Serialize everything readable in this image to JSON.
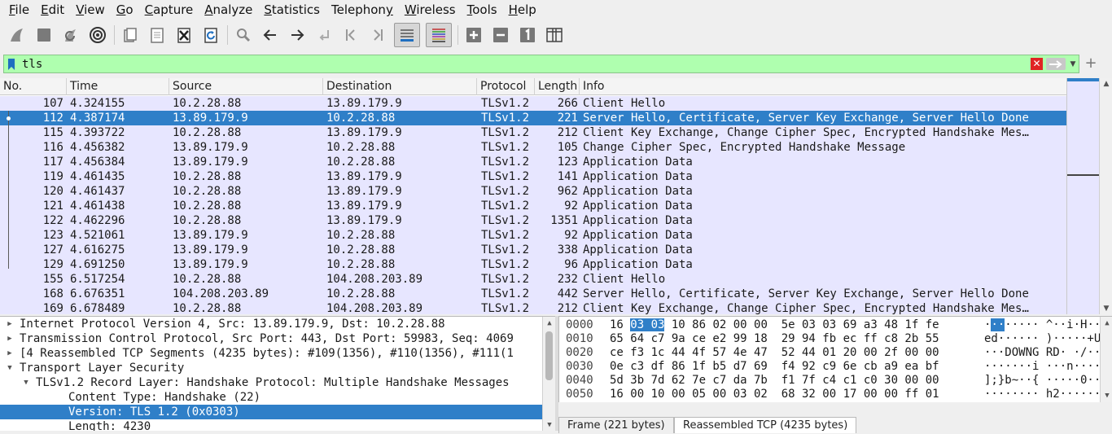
{
  "menu": [
    "File",
    "Edit",
    "View",
    "Go",
    "Capture",
    "Analyze",
    "Statistics",
    "Telephony",
    "Wireless",
    "Tools",
    "Help"
  ],
  "menu_mnemonics": [
    "F",
    "E",
    "V",
    "G",
    "C",
    "A",
    "S",
    "y",
    "W",
    "T",
    "H"
  ],
  "filter": {
    "value": "tls",
    "clear_symbol": "✕",
    "add_symbol": "+"
  },
  "columns": [
    "No.",
    "Time",
    "Source",
    "Destination",
    "Protocol",
    "Length",
    "Info"
  ],
  "packets": [
    {
      "no": "107",
      "time": "4.324155",
      "src": "10.2.28.88",
      "dst": "13.89.179.9",
      "proto": "TLSv1.2",
      "len": "266",
      "info": "Client Hello"
    },
    {
      "no": "112",
      "time": "4.387174",
      "src": "13.89.179.9",
      "dst": "10.2.28.88",
      "proto": "TLSv1.2",
      "len": "221",
      "info": "Server Hello, Certificate, Server Key Exchange, Server Hello Done"
    },
    {
      "no": "115",
      "time": "4.393722",
      "src": "10.2.28.88",
      "dst": "13.89.179.9",
      "proto": "TLSv1.2",
      "len": "212",
      "info": "Client Key Exchange, Change Cipher Spec, Encrypted Handshake Mes…"
    },
    {
      "no": "116",
      "time": "4.456382",
      "src": "13.89.179.9",
      "dst": "10.2.28.88",
      "proto": "TLSv1.2",
      "len": "105",
      "info": "Change Cipher Spec, Encrypted Handshake Message"
    },
    {
      "no": "117",
      "time": "4.456384",
      "src": "13.89.179.9",
      "dst": "10.2.28.88",
      "proto": "TLSv1.2",
      "len": "123",
      "info": "Application Data"
    },
    {
      "no": "119",
      "time": "4.461435",
      "src": "10.2.28.88",
      "dst": "13.89.179.9",
      "proto": "TLSv1.2",
      "len": "141",
      "info": "Application Data"
    },
    {
      "no": "120",
      "time": "4.461437",
      "src": "10.2.28.88",
      "dst": "13.89.179.9",
      "proto": "TLSv1.2",
      "len": "962",
      "info": "Application Data"
    },
    {
      "no": "121",
      "time": "4.461438",
      "src": "10.2.28.88",
      "dst": "13.89.179.9",
      "proto": "TLSv1.2",
      "len": "92",
      "info": "Application Data"
    },
    {
      "no": "122",
      "time": "4.462296",
      "src": "10.2.28.88",
      "dst": "13.89.179.9",
      "proto": "TLSv1.2",
      "len": "1351",
      "info": "Application Data"
    },
    {
      "no": "123",
      "time": "4.521061",
      "src": "13.89.179.9",
      "dst": "10.2.28.88",
      "proto": "TLSv1.2",
      "len": "92",
      "info": "Application Data"
    },
    {
      "no": "127",
      "time": "4.616275",
      "src": "13.89.179.9",
      "dst": "10.2.28.88",
      "proto": "TLSv1.2",
      "len": "338",
      "info": "Application Data"
    },
    {
      "no": "129",
      "time": "4.691250",
      "src": "13.89.179.9",
      "dst": "10.2.28.88",
      "proto": "TLSv1.2",
      "len": "96",
      "info": "Application Data"
    },
    {
      "no": "155",
      "time": "6.517254",
      "src": "10.2.28.88",
      "dst": "104.208.203.89",
      "proto": "TLSv1.2",
      "len": "232",
      "info": "Client Hello"
    },
    {
      "no": "168",
      "time": "6.676351",
      "src": "104.208.203.89",
      "dst": "10.2.28.88",
      "proto": "TLSv1.2",
      "len": "442",
      "info": "Server Hello, Certificate, Server Key Exchange, Server Hello Done"
    },
    {
      "no": "169",
      "time": "6.678489",
      "src": "10.2.28.88",
      "dst": "104.208.203.89",
      "proto": "TLSv1.2",
      "len": "212",
      "info": "Client Key Exchange, Change Cipher Spec, Encrypted Handshake Mes…"
    }
  ],
  "selected_packet_index": 1,
  "details": [
    {
      "text": "Internet Protocol Version 4, Src: 13.89.179.9, Dst: 10.2.28.88",
      "level": 0,
      "expander": "collapsed"
    },
    {
      "text": "Transmission Control Protocol, Src Port: 443, Dst Port: 59983, Seq: 4069",
      "level": 0,
      "expander": "collapsed"
    },
    {
      "text": "[4 Reassembled TCP Segments (4235 bytes): #109(1356), #110(1356), #111(1",
      "level": 0,
      "expander": "collapsed"
    },
    {
      "text": "Transport Layer Security",
      "level": 0,
      "expander": "expanded"
    },
    {
      "text": "TLSv1.2 Record Layer: Handshake Protocol: Multiple Handshake Messages",
      "level": 1,
      "expander": "expanded"
    },
    {
      "text": "Content Type: Handshake (22)",
      "level": 2,
      "expander": "none"
    },
    {
      "text": "Version: TLS 1.2 (0x0303)",
      "level": 2,
      "expander": "none",
      "selected": true
    },
    {
      "text": "Length: 4230",
      "level": 2,
      "expander": "none"
    }
  ],
  "bytes": [
    {
      "offset": "0000",
      "hex_pre": "16 ",
      "hex_hl": "03 03",
      "hex_post": " 10 86 02 00 00  5e 03 03 69 a3 48 1f fe",
      "asc_pre": "·",
      "asc_hl": "··",
      "asc_post": "····· ^··i·H··"
    },
    {
      "offset": "0010",
      "hex_pre": "65 64 c7 9a ce e2 99 18  29 94 fb ec ff c8 2b 55",
      "hex_hl": "",
      "hex_post": "",
      "asc_pre": "ed······ )·····+U",
      "asc_hl": "",
      "asc_post": ""
    },
    {
      "offset": "0020",
      "hex_pre": "ce f3 1c 44 4f 57 4e 47  52 44 01 20 00 2f 00 00",
      "hex_hl": "",
      "hex_post": "",
      "asc_pre": "···DOWNG RD· ·/··",
      "asc_hl": "",
      "asc_post": ""
    },
    {
      "offset": "0030",
      "hex_pre": "0e c3 df 86 1f b5 d7 69  f4 92 c9 6e cb a9 ea bf",
      "hex_hl": "",
      "hex_post": "",
      "asc_pre": "·······i ···n····",
      "asc_hl": "",
      "asc_post": ""
    },
    {
      "offset": "0040",
      "hex_pre": "5d 3b 7d 62 7e c7 da 7b  f1 7f c4 c1 c0 30 00 00",
      "hex_hl": "",
      "hex_post": "",
      "asc_pre": "];}b~··{ ·····0··",
      "asc_hl": "",
      "asc_post": ""
    },
    {
      "offset": "0050",
      "hex_pre": "16 00 10 00 05 00 03 02  68 32 00 17 00 00 ff 01",
      "hex_hl": "",
      "hex_post": "",
      "asc_pre": "········ h2······",
      "asc_hl": "",
      "asc_post": ""
    }
  ],
  "byte_tabs": [
    "Frame (221 bytes)",
    "Reassembled TCP (4235 bytes)"
  ],
  "colors": {
    "row_bg": "#e7e6ff",
    "selected": "#2f7fc8",
    "filter_ok": "#afffaf"
  }
}
